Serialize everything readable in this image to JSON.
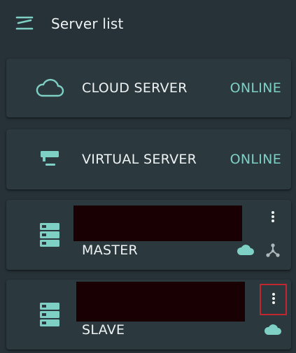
{
  "appbar": {
    "title": "Server list",
    "menu_icon": "menu-icon"
  },
  "servers": [
    {
      "name": "CLOUD SERVER",
      "status": "ONLINE",
      "icon": "cloud-outline-icon"
    },
    {
      "name": "VIRTUAL SERVER",
      "status": "ONLINE",
      "icon": "monitor-icon"
    },
    {
      "name": "MASTER",
      "icon": "server-stack-icon",
      "badges": [
        "cloud-icon",
        "network-icon"
      ],
      "more_icon": "more-vert-icon"
    },
    {
      "name": "SLAVE",
      "icon": "server-stack-icon",
      "badges": [
        "cloud-icon"
      ],
      "more_icon": "more-vert-icon"
    }
  ],
  "colors": {
    "background": "#263238",
    "card": "#2b393f",
    "accent": "#7ed0c5",
    "redaction": "#190003",
    "highlight": "#c0262d"
  }
}
